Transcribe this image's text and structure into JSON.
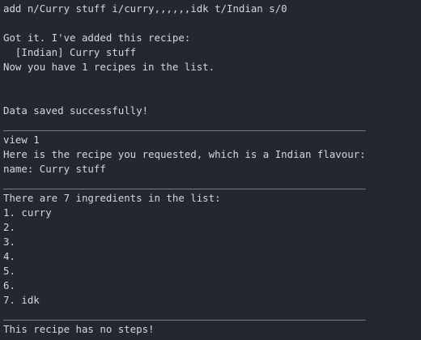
{
  "terminal": {
    "lines": [
      "add n/Curry stuff i/curry,,,,,,idk t/Indian s/0",
      "",
      "Got it. I've added this recipe:",
      "  [Indian] Curry stuff",
      "Now you have 1 recipes in the list.",
      "",
      "",
      "Data saved successfully!",
      "____________________________________________________________",
      "view 1",
      "Here is the recipe you requested, which is a Indian flavour:",
      "name: Curry stuff",
      "____________________________________________________________",
      "There are 7 ingredients in the list:",
      "1. curry",
      "2.",
      "3.",
      "4.",
      "5.",
      "6.",
      "7. idk",
      "____________________________________________________________",
      "This recipe has no steps!"
    ]
  },
  "colors": {
    "background": "#25272e",
    "text": "#d4d7de"
  }
}
